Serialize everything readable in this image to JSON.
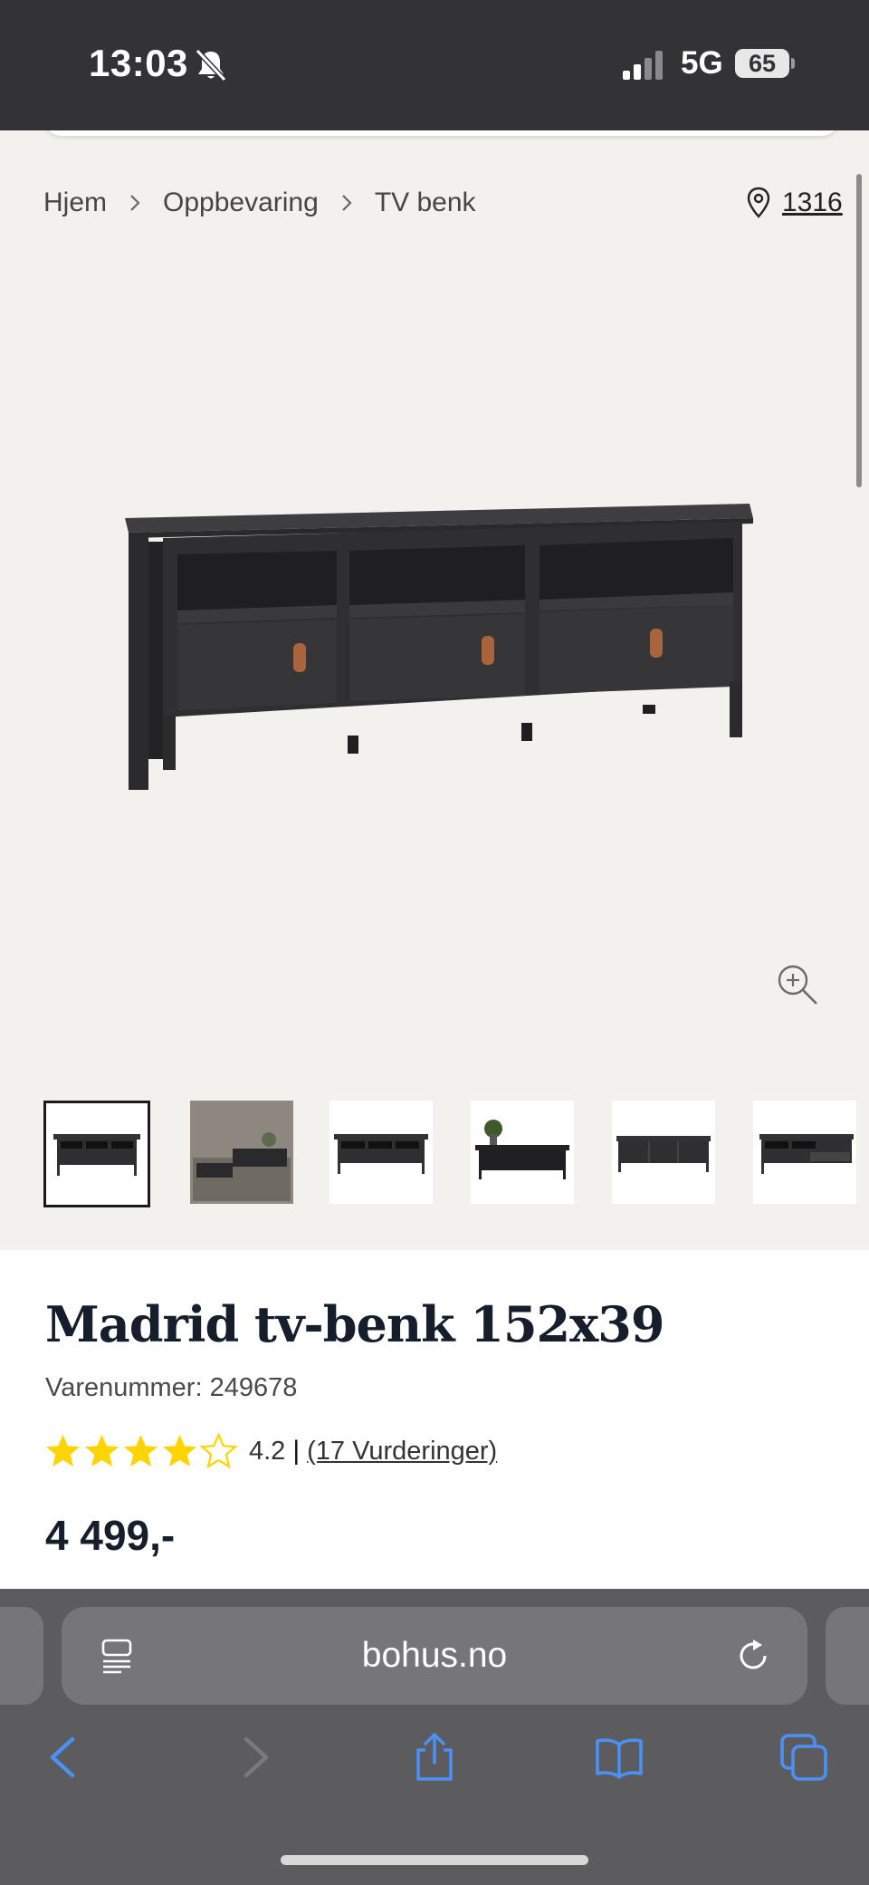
{
  "status_bar": {
    "time": "13:03",
    "network": "5G",
    "battery": "65"
  },
  "breadcrumb": {
    "items": [
      "Hjem",
      "Oppbevaring",
      "TV benk"
    ]
  },
  "store": {
    "label": "1316"
  },
  "product": {
    "title": "Madrid tv-benk 152x39",
    "sku": "Varenummer: 249678",
    "rating_value": "4.2",
    "rating_separator": "|",
    "reviews_label": "(17 Vurderinger)",
    "rating_stars": 4,
    "rating_max": 5,
    "price": "4 499,-"
  },
  "gallery": {
    "thumbnail_count": 6,
    "selected_index": 0
  },
  "browser": {
    "url": "bohus.no"
  },
  "colors": {
    "accent_star": "#FFD400",
    "title_text": "#161E2B",
    "browser_chrome": "#5C5C5E",
    "nav_icon_blue": "#4A90F5"
  }
}
